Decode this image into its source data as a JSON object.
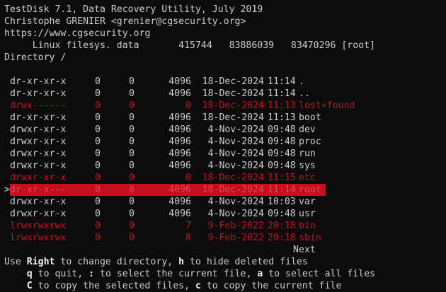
{
  "header": {
    "title": "TestDisk 7.1, Data Recovery Utility, July 2019",
    "author": "Christophe GRENIER <grenier@cgsecurity.org>",
    "url": "https://www.cgsecurity.org",
    "partition_line": "     Linux filesys. data       415744   83886039   83470296 [root]",
    "directory": "Directory /"
  },
  "cursor_glyph": ">",
  "entries": [
    {
      "perm": "dr-xr-xr-x",
      "uid": "0",
      "gid": "0",
      "size": "4096",
      "date": "18-Dec-2024",
      "time": "11:14",
      "name": ".",
      "deleted": false,
      "selected": false
    },
    {
      "perm": "dr-xr-xr-x",
      "uid": "0",
      "gid": "0",
      "size": "4096",
      "date": "18-Dec-2024",
      "time": "11:14",
      "name": "..",
      "deleted": false,
      "selected": false
    },
    {
      "perm": "drwx------",
      "uid": "0",
      "gid": "0",
      "size": "0",
      "date": "18-Dec-2024",
      "time": "11:13",
      "name": "lost+found",
      "deleted": true,
      "selected": false
    },
    {
      "perm": "dr-xr-xr-x",
      "uid": "0",
      "gid": "0",
      "size": "4096",
      "date": "18-Dec-2024",
      "time": "11:13",
      "name": "boot",
      "deleted": false,
      "selected": false
    },
    {
      "perm": "drwxr-xr-x",
      "uid": "0",
      "gid": "0",
      "size": "4096",
      "date": "4-Nov-2024",
      "time": "09:48",
      "name": "dev",
      "deleted": false,
      "selected": false
    },
    {
      "perm": "drwxr-xr-x",
      "uid": "0",
      "gid": "0",
      "size": "4096",
      "date": "4-Nov-2024",
      "time": "09:48",
      "name": "proc",
      "deleted": false,
      "selected": false
    },
    {
      "perm": "drwxr-xr-x",
      "uid": "0",
      "gid": "0",
      "size": "4096",
      "date": "4-Nov-2024",
      "time": "09:48",
      "name": "run",
      "deleted": false,
      "selected": false
    },
    {
      "perm": "drwxr-xr-x",
      "uid": "0",
      "gid": "0",
      "size": "4096",
      "date": "4-Nov-2024",
      "time": "09:48",
      "name": "sys",
      "deleted": false,
      "selected": false
    },
    {
      "perm": "drwxr-xr-x",
      "uid": "0",
      "gid": "0",
      "size": "0",
      "date": "18-Dec-2024",
      "time": "11:15",
      "name": "etc",
      "deleted": true,
      "selected": false
    },
    {
      "perm": "dr-xr-x---",
      "uid": "0",
      "gid": "0",
      "size": "4096",
      "date": "18-Dec-2024",
      "time": "11:14",
      "name": "root",
      "deleted": true,
      "selected": true
    },
    {
      "perm": "drwxr-xr-x",
      "uid": "0",
      "gid": "0",
      "size": "4096",
      "date": "4-Nov-2024",
      "time": "10:03",
      "name": "var",
      "deleted": false,
      "selected": false
    },
    {
      "perm": "drwxr-xr-x",
      "uid": "0",
      "gid": "0",
      "size": "4096",
      "date": "4-Nov-2024",
      "time": "09:48",
      "name": "usr",
      "deleted": false,
      "selected": false
    },
    {
      "perm": "lrwxrwxrwx",
      "uid": "0",
      "gid": "0",
      "size": "7",
      "date": "9-Feb-2022",
      "time": "20:18",
      "name": "bin",
      "deleted": true,
      "selected": false
    },
    {
      "perm": "lrwxrwxrwx",
      "uid": "0",
      "gid": "0",
      "size": "8",
      "date": "9-Feb-2022",
      "time": "20:18",
      "name": "sbin",
      "deleted": true,
      "selected": false
    }
  ],
  "pager": {
    "next_label": "Next"
  },
  "help": {
    "line1_pre": "Use ",
    "line1_key1": "Right",
    "line1_mid": " to change directory, ",
    "line1_key2": "h",
    "line1_post": " to hide deleted files",
    "line2_indent": "    ",
    "line2_key1": "q",
    "line2_mid1": " to quit, ",
    "line2_key2": ":",
    "line2_mid2": " to select the current file, ",
    "line2_key3": "a",
    "line2_post": " to select all files",
    "line3_indent": "    ",
    "line3_key1": "C",
    "line3_mid": " to copy the selected files, ",
    "line3_key2": "c",
    "line3_post": " to copy the current file"
  }
}
